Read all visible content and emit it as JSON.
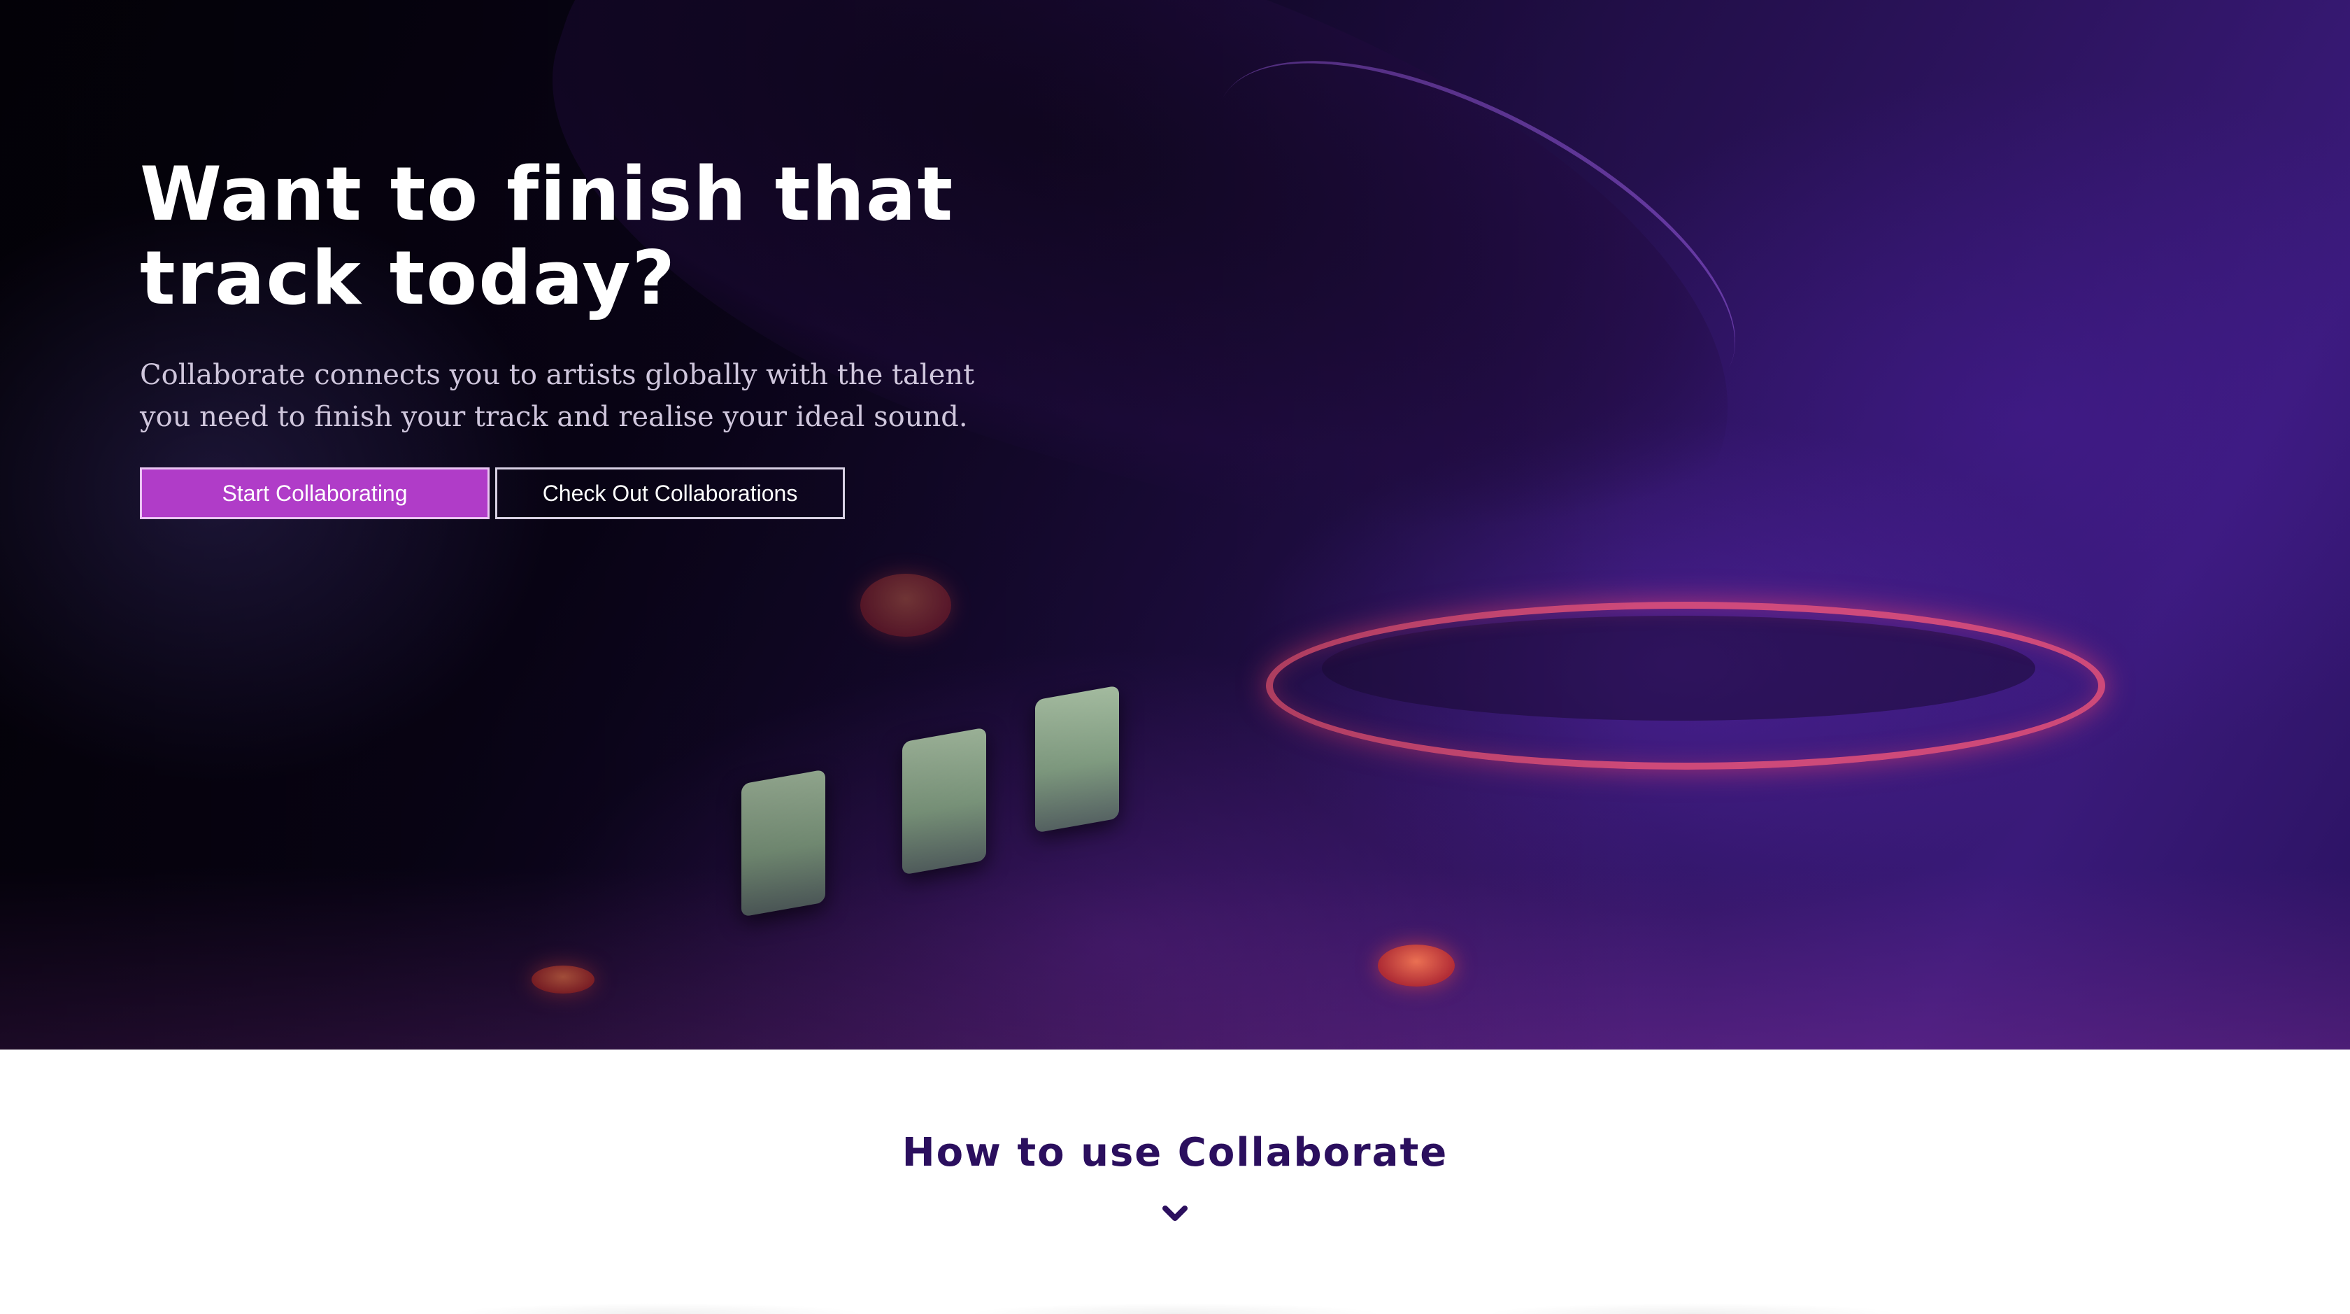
{
  "hero": {
    "title_line1": "Want to finish that",
    "title_line2": "track today?",
    "subtitle_line1": "Collaborate connects you to artists globally with the talent",
    "subtitle_line2": "you need to finish your track and realise your ideal sound.",
    "primary_button": "Start Collaborating",
    "secondary_button": "Check Out Collaborations"
  },
  "how_to": {
    "title": "How to use Collaborate",
    "icon": "chevron-down-icon"
  },
  "colors": {
    "primary_accent": "#b03cc8",
    "heading_dark": "#2b0f5e",
    "hero_text": "#ffffff"
  }
}
